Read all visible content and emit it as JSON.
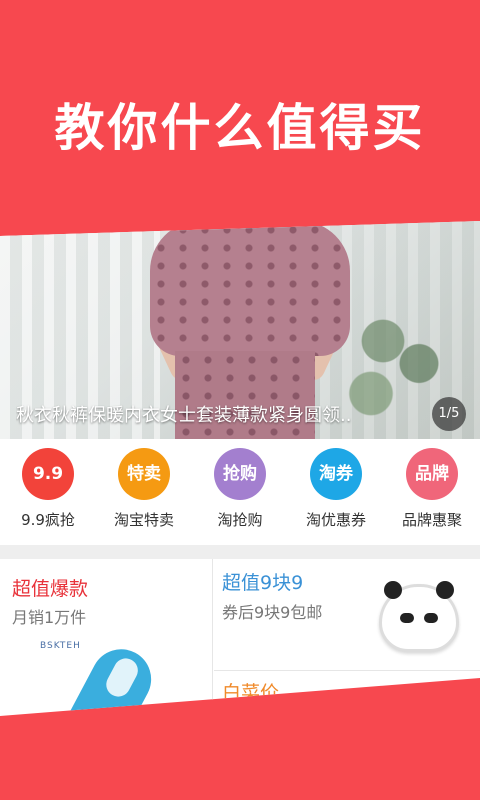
{
  "hero": {
    "title": "教你什么值得买"
  },
  "banner": {
    "caption": "秋衣秋裤保暖内衣女士套装薄款紧身圆领..",
    "indicator": "1/5"
  },
  "quick_nav": [
    {
      "badge": "9.9",
      "label": "9.9疯抢",
      "color": "#f2433a"
    },
    {
      "badge": "特卖",
      "label": "淘宝特卖",
      "color": "#f59a12"
    },
    {
      "badge": "抢购",
      "label": "淘抢购",
      "color": "#a37fcf"
    },
    {
      "badge": "淘券",
      "label": "淘优惠券",
      "color": "#1ea7e6"
    },
    {
      "badge": "品牌",
      "label": "品牌惠聚",
      "color": "#f0667a"
    }
  ],
  "promos": {
    "left": {
      "title": "超值爆款",
      "subtitle": "月销1万件",
      "brand": "BSKTEH"
    },
    "right_top": {
      "title": "超值9块9",
      "subtitle": "券后9块9包邮"
    },
    "right_bottom": {
      "title": "白菜价"
    }
  },
  "colors": {
    "brand_red": "#f7484f"
  }
}
